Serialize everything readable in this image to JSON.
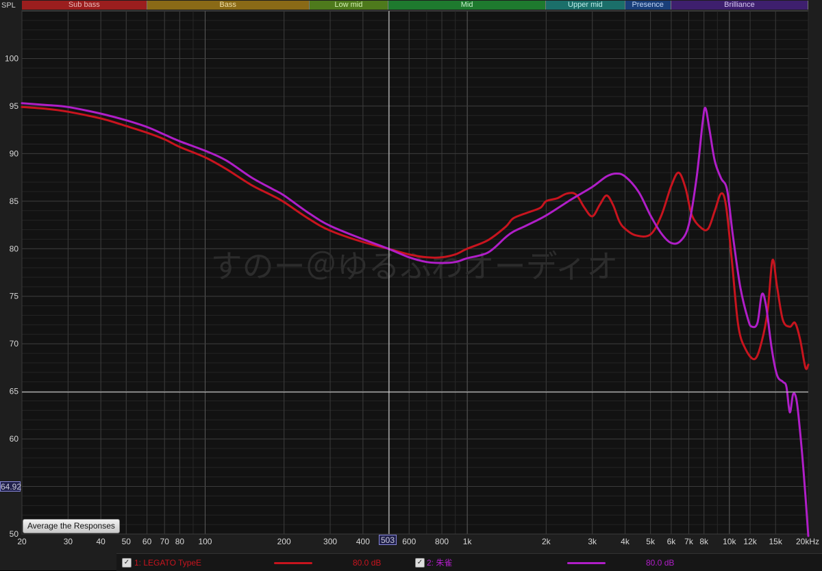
{
  "axis": {
    "y_label": "SPL",
    "x_unit_label": "20kHz"
  },
  "bands": [
    {
      "name": "Sub bass",
      "from": 20,
      "to": 60,
      "color": "#9b1e1e",
      "text": "#e9b9b9"
    },
    {
      "name": "Bass",
      "from": 60,
      "to": 250,
      "color": "#8a6a16",
      "text": "#f0dfa8"
    },
    {
      "name": "Low mid",
      "from": 250,
      "to": 500,
      "color": "#4e7a1c",
      "text": "#d2efb0"
    },
    {
      "name": "Mid",
      "from": 500,
      "to": 2000,
      "color": "#1e7a2e",
      "text": "#c6f0cc"
    },
    {
      "name": "Upper mid",
      "from": 2000,
      "to": 4000,
      "color": "#1b6f6a",
      "text": "#bdeeea"
    },
    {
      "name": "Presence",
      "from": 4000,
      "to": 6000,
      "color": "#1a3f7a",
      "text": "#c0d4f5"
    },
    {
      "name": "Brilliance",
      "from": 6000,
      "to": 20000,
      "color": "#3e1f6e",
      "text": "#d6c6f2"
    }
  ],
  "controls": {
    "average_button": "Average the Responses"
  },
  "cursor": {
    "y_readout": "64.92",
    "x_readout": "503",
    "x_value": 503,
    "y_value": 64.92
  },
  "watermark": "すのー＠ゆるふわオーディオ",
  "legend": [
    {
      "label": "1: LEGATO TypeE",
      "level": "80.0 dB",
      "color": "#c8141e",
      "checked": true
    },
    {
      "label": "2: 朱雀",
      "level": "80.0 dB",
      "color": "#b01ec8",
      "checked": true
    }
  ],
  "chart_data": {
    "type": "line",
    "xscale": "log",
    "xlim": [
      20,
      20000
    ],
    "ylim": [
      50,
      105
    ],
    "grid": true,
    "ylabel": "SPL",
    "yticks": [
      50,
      55,
      60,
      65,
      70,
      75,
      80,
      85,
      90,
      95,
      100
    ],
    "xticks": [
      {
        "v": 20,
        "l": "20"
      },
      {
        "v": 30,
        "l": "30"
      },
      {
        "v": 40,
        "l": "40"
      },
      {
        "v": 50,
        "l": "50"
      },
      {
        "v": 60,
        "l": "60"
      },
      {
        "v": 70,
        "l": "70"
      },
      {
        "v": 80,
        "l": "80"
      },
      {
        "v": 100,
        "l": "100"
      },
      {
        "v": 200,
        "l": "200"
      },
      {
        "v": 300,
        "l": "300"
      },
      {
        "v": 400,
        "l": "400"
      },
      {
        "v": 600,
        "l": "600"
      },
      {
        "v": 800,
        "l": "800"
      },
      {
        "v": 1000,
        "l": "1k"
      },
      {
        "v": 2000,
        "l": "2k"
      },
      {
        "v": 3000,
        "l": "3k"
      },
      {
        "v": 4000,
        "l": "4k"
      },
      {
        "v": 5000,
        "l": "5k"
      },
      {
        "v": 6000,
        "l": "6k"
      },
      {
        "v": 7000,
        "l": "7k"
      },
      {
        "v": 8000,
        "l": "8k"
      },
      {
        "v": 10000,
        "l": "10k"
      },
      {
        "v": 12000,
        "l": "12k"
      },
      {
        "v": 15000,
        "l": "15k"
      }
    ],
    "series": [
      {
        "name": "1: LEGATO TypeE",
        "color": "#c8141e",
        "points": [
          [
            20,
            94.9
          ],
          [
            25,
            94.7
          ],
          [
            30,
            94.4
          ],
          [
            40,
            93.7
          ],
          [
            50,
            92.9
          ],
          [
            60,
            92.2
          ],
          [
            70,
            91.5
          ],
          [
            80,
            90.7
          ],
          [
            100,
            89.6
          ],
          [
            120,
            88.4
          ],
          [
            150,
            86.7
          ],
          [
            180,
            85.6
          ],
          [
            200,
            84.9
          ],
          [
            250,
            83.1
          ],
          [
            300,
            81.9
          ],
          [
            400,
            80.7
          ],
          [
            500,
            80.0
          ],
          [
            600,
            79.4
          ],
          [
            700,
            79.1
          ],
          [
            800,
            79.1
          ],
          [
            900,
            79.4
          ],
          [
            1000,
            80.0
          ],
          [
            1200,
            80.9
          ],
          [
            1400,
            82.3
          ],
          [
            1500,
            83.2
          ],
          [
            1700,
            83.8
          ],
          [
            1900,
            84.3
          ],
          [
            2000,
            85.0
          ],
          [
            2200,
            85.3
          ],
          [
            2400,
            85.8
          ],
          [
            2600,
            85.7
          ],
          [
            2800,
            84.3
          ],
          [
            3000,
            83.4
          ],
          [
            3200,
            84.6
          ],
          [
            3400,
            85.6
          ],
          [
            3600,
            84.6
          ],
          [
            3800,
            82.9
          ],
          [
            4000,
            82.1
          ],
          [
            4400,
            81.4
          ],
          [
            5000,
            81.5
          ],
          [
            5500,
            83.5
          ],
          [
            6000,
            86.6
          ],
          [
            6400,
            88.0
          ],
          [
            6800,
            86.4
          ],
          [
            7200,
            83.5
          ],
          [
            7800,
            82.2
          ],
          [
            8300,
            82.1
          ],
          [
            8800,
            84.0
          ],
          [
            9300,
            85.8
          ],
          [
            9700,
            84.6
          ],
          [
            10200,
            79.0
          ],
          [
            10800,
            72.0
          ],
          [
            11500,
            69.5
          ],
          [
            12500,
            68.4
          ],
          [
            13300,
            70.3
          ],
          [
            14000,
            73.5
          ],
          [
            14600,
            78.8
          ],
          [
            15200,
            76.0
          ],
          [
            16000,
            72.5
          ],
          [
            17000,
            71.8
          ],
          [
            17800,
            72.2
          ],
          [
            18600,
            70.5
          ],
          [
            19500,
            67.5
          ],
          [
            20000,
            67.8
          ]
        ]
      },
      {
        "name": "2: 朱雀",
        "color": "#b01ec8",
        "points": [
          [
            20,
            95.3
          ],
          [
            25,
            95.1
          ],
          [
            30,
            94.9
          ],
          [
            40,
            94.2
          ],
          [
            50,
            93.5
          ],
          [
            60,
            92.8
          ],
          [
            70,
            92.0
          ],
          [
            80,
            91.3
          ],
          [
            100,
            90.3
          ],
          [
            120,
            89.3
          ],
          [
            150,
            87.5
          ],
          [
            180,
            86.3
          ],
          [
            200,
            85.6
          ],
          [
            250,
            83.7
          ],
          [
            300,
            82.4
          ],
          [
            400,
            81.0
          ],
          [
            500,
            80.0
          ],
          [
            600,
            79.1
          ],
          [
            700,
            78.6
          ],
          [
            800,
            78.5
          ],
          [
            900,
            78.6
          ],
          [
            1000,
            79.0
          ],
          [
            1200,
            79.6
          ],
          [
            1400,
            81.2
          ],
          [
            1500,
            81.8
          ],
          [
            1700,
            82.5
          ],
          [
            2000,
            83.5
          ],
          [
            2500,
            85.2
          ],
          [
            3000,
            86.5
          ],
          [
            3400,
            87.6
          ],
          [
            3700,
            87.9
          ],
          [
            4000,
            87.6
          ],
          [
            4500,
            86.0
          ],
          [
            5000,
            83.5
          ],
          [
            5500,
            81.6
          ],
          [
            6000,
            80.6
          ],
          [
            6500,
            80.8
          ],
          [
            7000,
            82.5
          ],
          [
            7500,
            87.5
          ],
          [
            7900,
            93.2
          ],
          [
            8100,
            94.8
          ],
          [
            8400,
            92.5
          ],
          [
            8800,
            89.2
          ],
          [
            9300,
            87.4
          ],
          [
            9800,
            86.2
          ],
          [
            10300,
            81.5
          ],
          [
            11000,
            76.0
          ],
          [
            11800,
            72.5
          ],
          [
            12200,
            71.8
          ],
          [
            12800,
            72.2
          ],
          [
            13300,
            75.2
          ],
          [
            13800,
            74.0
          ],
          [
            14500,
            69.5
          ],
          [
            15200,
            66.7
          ],
          [
            16000,
            66.0
          ],
          [
            16500,
            65.5
          ],
          [
            17000,
            62.8
          ],
          [
            17500,
            64.7
          ],
          [
            18000,
            64.2
          ],
          [
            18500,
            61.5
          ],
          [
            19200,
            56.5
          ],
          [
            20000,
            49.8
          ]
        ]
      }
    ]
  }
}
